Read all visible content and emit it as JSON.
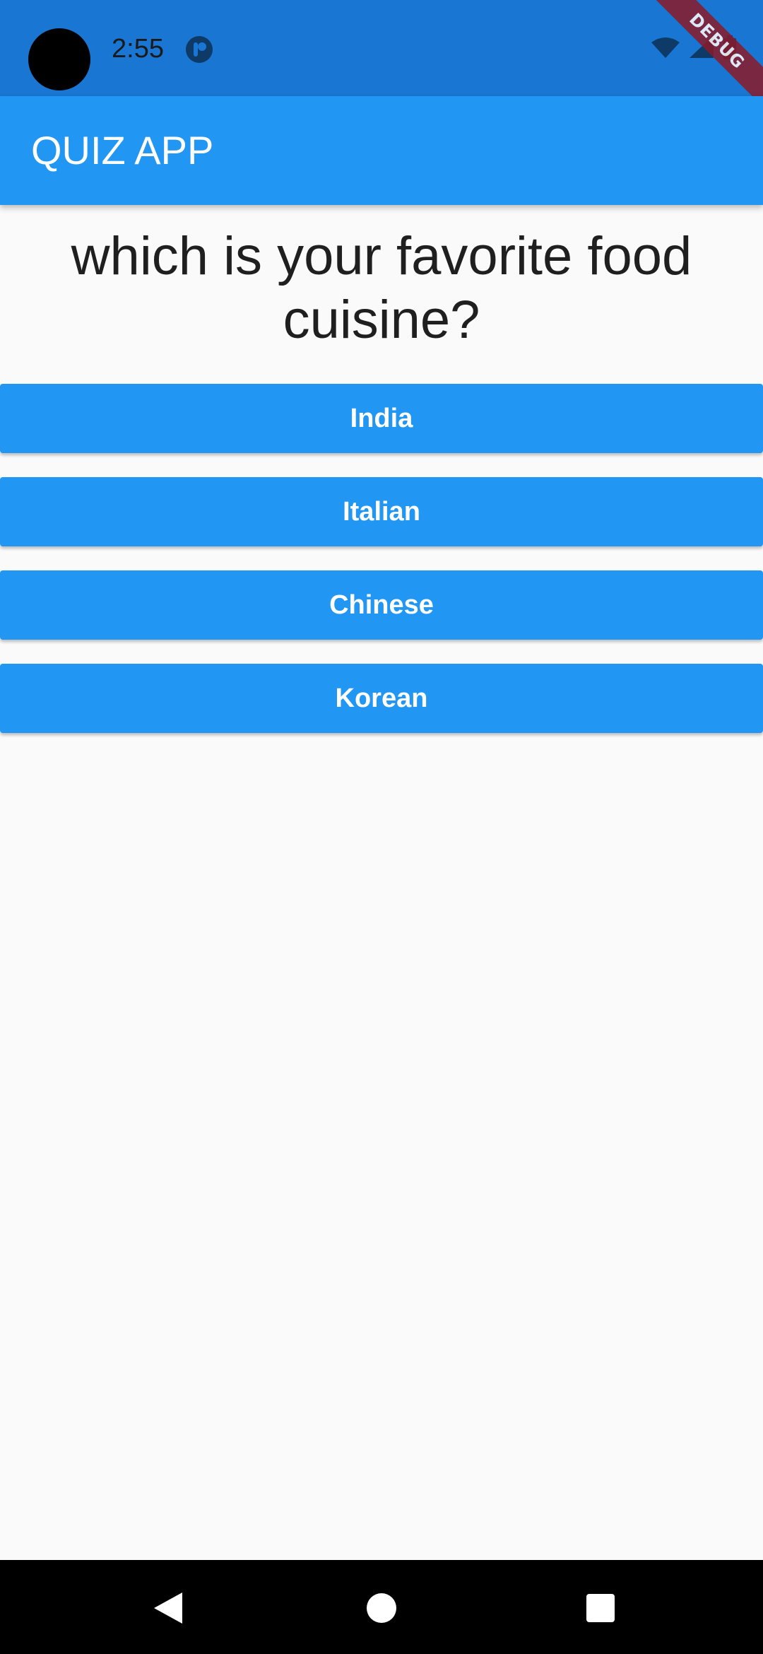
{
  "status_bar": {
    "time": "2:55",
    "debug_label": "DEBUG",
    "colors": {
      "background": "#1976D2"
    }
  },
  "app_bar": {
    "title": "QUIZ APP",
    "colors": {
      "background": "#2196F3",
      "text": "#FFFFFF"
    }
  },
  "quiz": {
    "question": "which is your favorite food cuisine?",
    "answers": [
      {
        "label": "India"
      },
      {
        "label": "Italian"
      },
      {
        "label": "Chinese"
      },
      {
        "label": "Korean"
      }
    ],
    "colors": {
      "button": "#2196F3",
      "button_text": "#FFFFFF",
      "background": "#FAFAFA"
    }
  },
  "navigation": {
    "buttons": [
      "back-icon",
      "home-icon",
      "recents-icon"
    ]
  }
}
